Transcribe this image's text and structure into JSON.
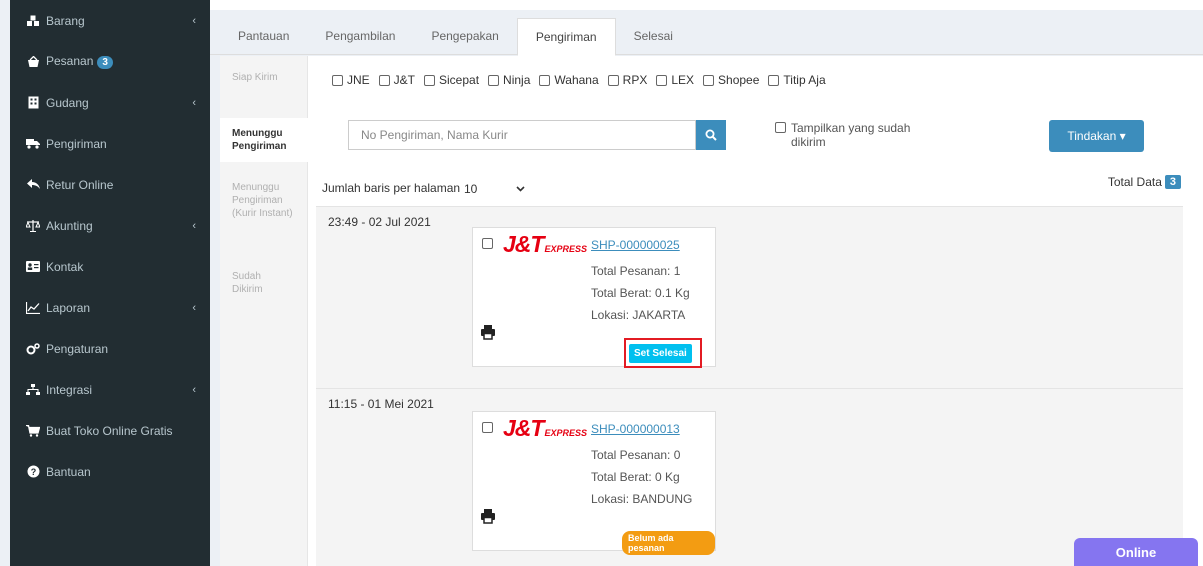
{
  "sidebar": {
    "items": [
      {
        "label": "Barang",
        "icon": "cubes-icon",
        "chevron": "‹"
      },
      {
        "label": "Pesanan",
        "icon": "basket-icon",
        "badge": "3"
      },
      {
        "label": "Gudang",
        "icon": "building-icon",
        "chevron": "‹"
      },
      {
        "label": "Pengiriman",
        "icon": "truck-icon"
      },
      {
        "label": "Retur Online",
        "icon": "reply-icon"
      },
      {
        "label": "Akunting",
        "icon": "balance-scale-icon",
        "chevron": "‹"
      },
      {
        "label": "Kontak",
        "icon": "address-card-icon"
      },
      {
        "label": "Laporan",
        "icon": "line-chart-icon",
        "chevron": "‹"
      },
      {
        "label": "Pengaturan",
        "icon": "gears-icon"
      },
      {
        "label": "Integrasi",
        "icon": "sitemap-icon",
        "chevron": "‹"
      },
      {
        "label": "Buat Toko Online Gratis",
        "icon": "cart-icon"
      },
      {
        "label": "Bantuan",
        "icon": "question-circle-icon"
      }
    ]
  },
  "tabs": [
    "Pantauan",
    "Pengambilan",
    "Pengepakan",
    "Pengiriman",
    "Selesai"
  ],
  "subtabs": [
    "Siap Kirim",
    "Menunggu Pengiriman",
    "Menunggu Pengiriman (Kurir Instant)",
    "Sudah Dikirim"
  ],
  "couriers": [
    "JNE",
    "J&T",
    "Sicepat",
    "Ninja",
    "Wahana",
    "RPX",
    "LEX",
    "Shopee",
    "Titip Aja"
  ],
  "search": {
    "placeholder": "No Pengiriman, Nama Kurir"
  },
  "show_sent_label": "Tampilkan yang sudah dikirim",
  "action_button": "Tindakan ▾",
  "rows_per_page": {
    "label": "Jumlah baris per halaman",
    "value": "10"
  },
  "total": {
    "label": "Total Data",
    "count": "3"
  },
  "groups": [
    {
      "date": "23:49 - 02 Jul 2021",
      "shipment": {
        "courier_logo": "J&T",
        "courier_sub": "EXPRESS",
        "id": "SHP-000000025",
        "total_orders": "Total Pesanan: 1",
        "total_weight": "Total Berat: 0.1 Kg",
        "location": "Lokasi: JAKARTA",
        "action": "Set Selesai"
      }
    },
    {
      "date": "11:15 - 01 Mei 2021",
      "shipment": {
        "courier_logo": "J&T",
        "courier_sub": "EXPRESS",
        "id": "SHP-000000013",
        "total_orders": "Total Pesanan: 0",
        "total_weight": "Total Berat: 0 Kg",
        "location": "Lokasi: BANDUNG",
        "status": "Belum ada pesanan"
      }
    }
  ],
  "online_button": "Online"
}
